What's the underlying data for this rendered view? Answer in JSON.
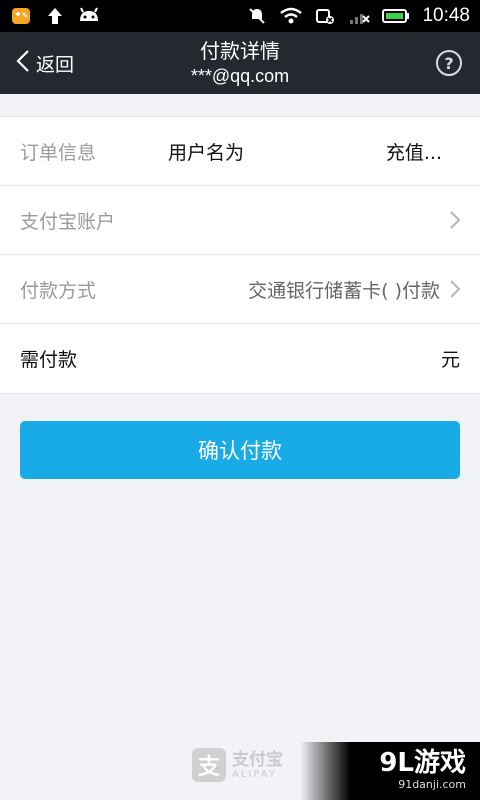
{
  "status_bar": {
    "time": "10:48",
    "icons_left": [
      "game-icon",
      "upload-arrow-icon",
      "android-icon"
    ],
    "icons_right": [
      "mute-icon",
      "wifi-icon",
      "data-icon",
      "signal-icon",
      "battery-icon"
    ]
  },
  "header": {
    "back_label": "返回",
    "title": "付款详情",
    "subtitle": "***@qq.com",
    "help_label": "?"
  },
  "rows": {
    "order": {
      "label": "订单信息",
      "value_left": "用户名为",
      "value_right": "充值..."
    },
    "account": {
      "label": "支付宝账户",
      "value": ""
    },
    "method": {
      "label": "付款方式",
      "value": "交通银行储蓄卡(        )付款"
    },
    "amount": {
      "label": "需付款",
      "value": "元"
    }
  },
  "confirm_label": "确认付款",
  "footer": {
    "brand_zh": "支付宝",
    "brand_en": "ALIPAY",
    "logo_char": "支"
  },
  "watermark": {
    "main": "9L游戏",
    "sub": "91danji.com"
  },
  "colors": {
    "header_bg": "#23292f",
    "button_bg": "#18abe7",
    "page_bg": "#f2f3f7"
  }
}
